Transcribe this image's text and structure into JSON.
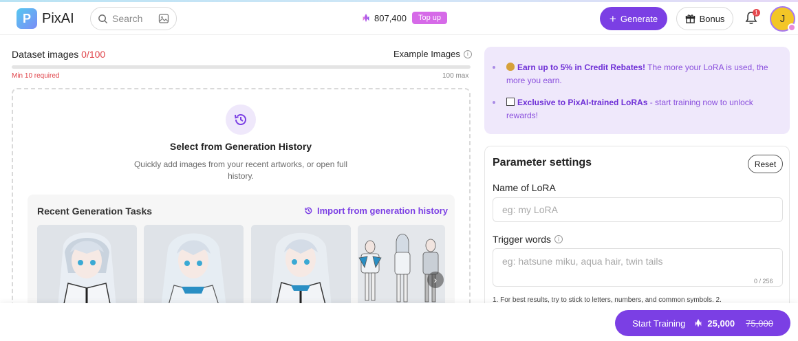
{
  "header": {
    "brand": "PixAI",
    "search_placeholder": "Search",
    "credits": "807,400",
    "topup_label": "Top up",
    "generate_label": "Generate",
    "bonus_label": "Bonus",
    "notification_count": "1",
    "avatar_initial": "J"
  },
  "dataset": {
    "title": "Dataset images",
    "count": "0/100",
    "example_label": "Example Images",
    "progress": 0,
    "min_label": "Min 10 required",
    "max_label": "100 max",
    "select_title": "Select from Generation History",
    "select_desc": "Quickly add images from your recent artworks, or open full history.",
    "recent_title": "Recent Generation Tasks",
    "import_label": "Import from generation history"
  },
  "promo": {
    "items": [
      {
        "bold": "Earn up to 5% in Credit Rebates!",
        "text": " The more your LoRA is used, the more you earn."
      },
      {
        "bold": "Exclusive to PixAI-trained LoRAs",
        "text": " - start training now to unlock rewards!"
      }
    ]
  },
  "params": {
    "title": "Parameter settings",
    "reset_label": "Reset",
    "name_label": "Name of LoRA",
    "name_placeholder": "eg: my LoRA",
    "trigger_label": "Trigger words",
    "trigger_placeholder": "eg: hatsune miku, aqua hair, twin tails",
    "trigger_counter": "0 / 256",
    "hint": "1. For best results, try to stick to letters, numbers, and common symbols. 2."
  },
  "footer": {
    "train_label": "Start Training",
    "price": "25,000",
    "old_price": "75,000"
  },
  "colors": {
    "accent": "#7b3fe4",
    "danger": "#e0444a",
    "promo_bg": "#efe8fb"
  }
}
